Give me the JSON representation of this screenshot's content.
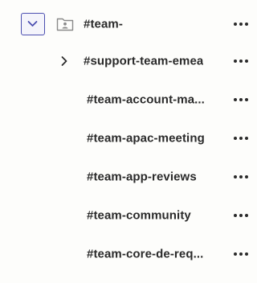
{
  "tree": {
    "root": {
      "label": "#team-",
      "expanded": true,
      "icon": "folder-user-icon",
      "toggle_icon": "chevron-down-icon",
      "more_icon": "more-horizontal-icon"
    },
    "children": [
      {
        "label": "#support-team-emea",
        "has_children": true,
        "toggle_icon": "chevron-right-icon"
      },
      {
        "label": "#team-account-ma..."
      },
      {
        "label": "#team-apac-meeting"
      },
      {
        "label": "#team-app-reviews"
      },
      {
        "label": "#team-community"
      },
      {
        "label": "#team-core-de-req..."
      }
    ]
  },
  "colors": {
    "background": "#fdfdfb",
    "text": "#2a2a2a",
    "accent_border": "#4b4fb0",
    "icon_gray": "#8a8a8a"
  }
}
